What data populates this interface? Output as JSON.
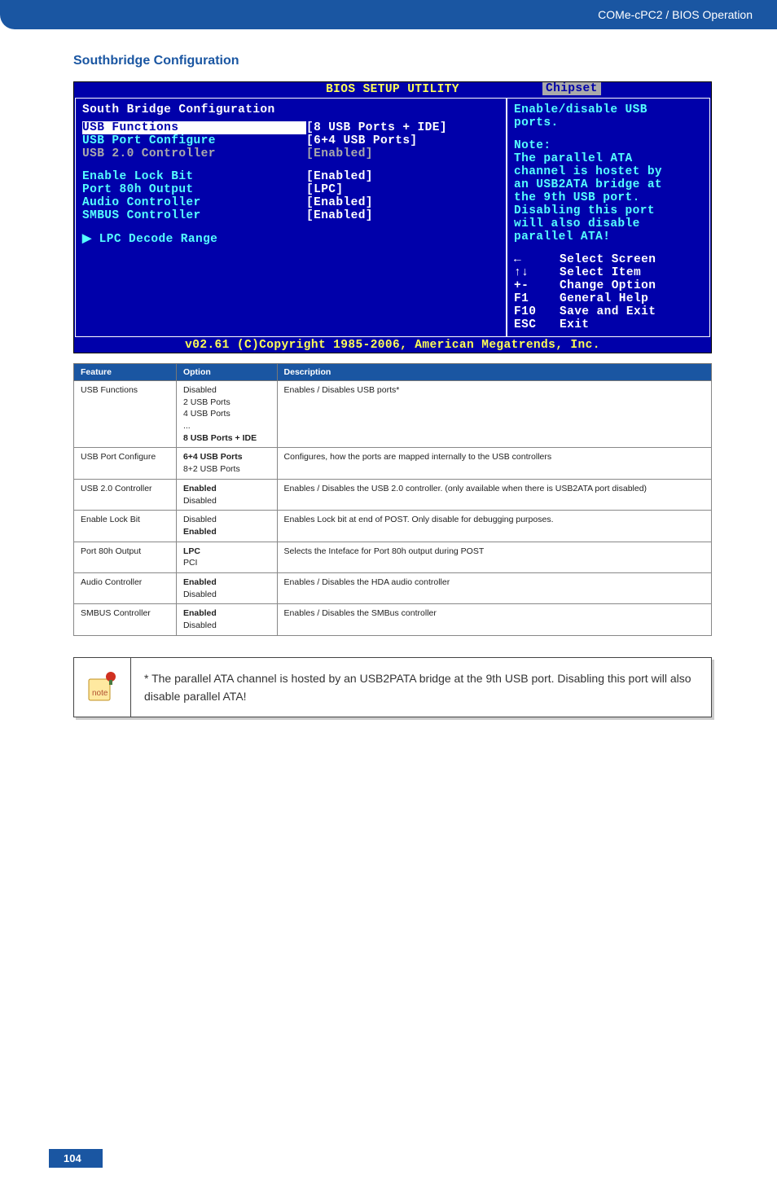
{
  "header": {
    "title": "COMe-cPC2 / BIOS Operation"
  },
  "section_title": "Southbridge Configuration",
  "bios": {
    "title": "BIOS SETUP UTILITY",
    "tab": "Chipset",
    "panel_title": "South Bridge Configuration",
    "rows": [
      {
        "label": "USB Functions",
        "value": "[8 USB Ports + IDE]",
        "selected": true
      },
      {
        "label": "USB Port Configure",
        "value": "[6+4 USB Ports]"
      },
      {
        "label": "USB 2.0 Controller",
        "value": "[Enabled]",
        "dim": true
      },
      {
        "spacer": true
      },
      {
        "label": "Enable Lock Bit",
        "value": "[Enabled]"
      },
      {
        "label": "Port 80h Output",
        "value": "[LPC]"
      },
      {
        "label": "Audio Controller",
        "value": "[Enabled]"
      },
      {
        "label": "SMBUS Controller",
        "value": "[Enabled]"
      },
      {
        "spacer": true
      },
      {
        "label": "▶ LPC Decode Range",
        "value": ""
      }
    ],
    "help": {
      "title1": "Enable/disable USB",
      "title2": "ports.",
      "note_label": "Note:",
      "note_lines": [
        "The parallel ATA",
        "channel is hostet by",
        "an USB2ATA bridge at",
        "the 9th USB port.",
        "Disabling this port",
        "will also disable",
        "parallel ATA!"
      ],
      "nav": [
        {
          "sym": "←",
          "text": "Select Screen"
        },
        {
          "sym": "↑↓",
          "text": "Select Item"
        },
        {
          "sym": "+-",
          "text": "Change Option"
        },
        {
          "sym": "F1",
          "text": "General Help"
        },
        {
          "sym": "F10",
          "text": "Save and Exit"
        },
        {
          "sym": "ESC",
          "text": "Exit"
        }
      ]
    },
    "footer": "v02.61 (C)Copyright 1985-2006, American Megatrends, Inc."
  },
  "table": {
    "headers": [
      "Feature",
      "Option",
      "Description"
    ],
    "rows": [
      {
        "feature": "USB Functions",
        "options": [
          "Disabled",
          "2 USB Ports",
          "4 USB Ports",
          "...",
          "<b>8 USB Ports + IDE</b>"
        ],
        "desc": "Enables / Disables USB ports*"
      },
      {
        "feature": "USB Port Configure",
        "options": [
          "<b>6+4 USB Ports</b>",
          "8+2 USB Ports"
        ],
        "desc": "Configures, how the ports are mapped internally to the USB controllers"
      },
      {
        "feature": "USB 2.0 Controller",
        "options": [
          "<b>Enabled</b>",
          "Disabled"
        ],
        "desc": "Enables / Disables the USB 2.0 controller. (only available when there is USB2ATA port disabled)"
      },
      {
        "feature": "Enable Lock Bit",
        "options": [
          "Disabled",
          "<b>Enabled</b>"
        ],
        "desc": "Enables Lock bit at end of POST. Only disable for debugging purposes."
      },
      {
        "feature": "Port 80h Output",
        "options": [
          "<b>LPC</b>",
          "PCI"
        ],
        "desc": "Selects the Inteface for Port 80h output during POST"
      },
      {
        "feature": "Audio Controller",
        "options": [
          "<b>Enabled</b>",
          "Disabled"
        ],
        "desc": "Enables / Disables the HDA audio controller"
      },
      {
        "feature": "SMBUS Controller",
        "options": [
          "<b>Enabled</b>",
          "Disabled"
        ],
        "desc": "Enables / Disables the SMBus controller"
      }
    ]
  },
  "note": "* The parallel ATA channel is hosted by an USB2PATA bridge at the 9th USB port. Disabling this port will also disable parallel ATA!",
  "page_number": "104"
}
